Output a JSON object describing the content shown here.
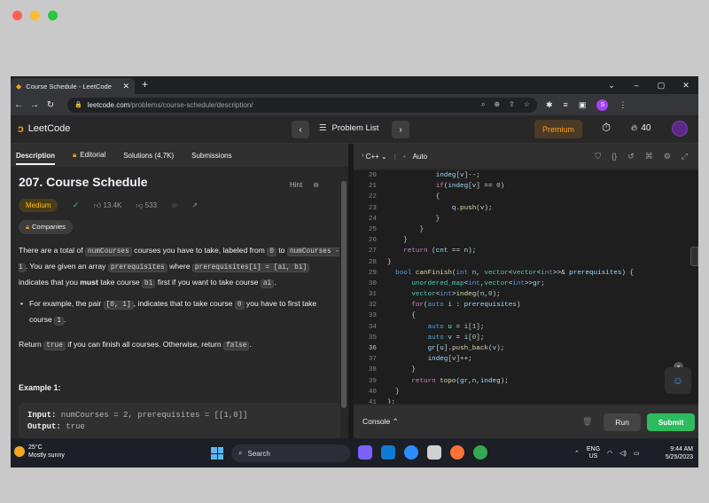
{
  "browser": {
    "tab_title": "Course Schedule - LeetCode",
    "tab_close": "✕",
    "new_tab": "+",
    "url_host": "leetcode.com",
    "url_path": "/problems/course-schedule/description/",
    "profile_initial": "S",
    "window_controls": [
      "⌄",
      "–",
      "▢",
      "✕"
    ]
  },
  "header": {
    "logo_text": "LeetCode",
    "problem_list": "Problem List",
    "premium": "Premium",
    "streak_count": "40"
  },
  "left": {
    "tabs": [
      "Description",
      "Editorial",
      "Solutions (4.7K)",
      "Submissions"
    ],
    "title": "207. Course Schedule",
    "hint": "Hint",
    "difficulty": "Medium",
    "likes": "13.4K",
    "dislikes": "533",
    "companies": "Companies",
    "p1_a": "There are a total of ",
    "p1_code1": "numCourses",
    "p1_b": " courses you have to take, labeled from ",
    "p1_code2": "0",
    "p1_c": " to ",
    "p1_code3": "numCourses - 1",
    "p1_d": ". You are given an array ",
    "p1_code4": "prerequisites",
    "p1_e": " where ",
    "p1_code5": "prerequisites[i] = [ai, bi]",
    "p1_f": " indicates that you ",
    "p1_must": "must",
    "p1_g": " take course ",
    "p1_code6": "bi",
    "p1_h": " first if you want to take course ",
    "p1_code7": "ai",
    "p1_i": ".",
    "b1_a": "For example, the pair ",
    "b1_code1": "[0, 1]",
    "b1_b": ", indicates that to take course ",
    "b1_code2": "0",
    "b1_c": " you have to first take course ",
    "b1_code3": "1",
    "b1_d": ".",
    "p2_a": "Return ",
    "p2_code1": "true",
    "p2_b": " if you can finish all courses. Otherwise, return ",
    "p2_code2": "false",
    "p2_c": ".",
    "example_heading": "Example 1:",
    "ex_input_label": "Input:",
    "ex_input_value": " numCourses = 2, prerequisites = [[1,0]]",
    "ex_output_label": "Output:",
    "ex_output_value": " true"
  },
  "right": {
    "language": "C++",
    "mode": "Auto",
    "console": "Console",
    "run": "Run",
    "submit": "Submit"
  },
  "code_lines": [
    {
      "n": "20",
      "html": "            <span class='vr'>indeg</span>[<span class='vr'>v</span>]--;"
    },
    {
      "n": "21",
      "html": "            <span class='kw2'>if</span>(<span class='vr'>indeg</span>[<span class='vr'>v</span>] == <span class='nm'>0</span>)"
    },
    {
      "n": "22",
      "html": "            {"
    },
    {
      "n": "23",
      "html": "                <span class='vr'>q</span>.<span class='fn'>push</span>(<span class='vr'>v</span>);"
    },
    {
      "n": "24",
      "html": "            }"
    },
    {
      "n": "25",
      "html": "        }"
    },
    {
      "n": "26",
      "html": "    }"
    },
    {
      "n": "27",
      "html": "    <span class='kw2'>return</span> (<span class='vr'>cnt</span> == <span class='vr'>n</span>);"
    },
    {
      "n": "28",
      "html": "}"
    },
    {
      "n": "29",
      "html": "  <span class='kw'>bool</span> <span class='fn'>canFinish</span>(<span class='kw'>int</span> <span class='vr'>n</span>, <span class='ty'>vector</span>&lt;<span class='ty'>vector</span>&lt;<span class='kw'>int</span>&gt;&gt;&amp; <span class='vr'>prerequisites</span>) {"
    },
    {
      "n": "30",
      "html": "      <span class='ty'>unordered_map</span>&lt;<span class='kw'>int</span>,<span class='ty'>vector</span>&lt;<span class='kw'>int</span>&gt;&gt;<span class='vr'>gr</span>;"
    },
    {
      "n": "31",
      "html": "      <span class='ty'>vector</span>&lt;<span class='kw'>int</span>&gt;<span class='fn'>indeg</span>(<span class='vr'>n</span>,<span class='nm'>0</span>);"
    },
    {
      "n": "32",
      "html": "      <span class='kw2'>for</span>(<span class='kw'>auto</span> <span class='vr'>i</span> : <span class='vr'>prerequisites</span>)"
    },
    {
      "n": "33",
      "html": "      {"
    },
    {
      "n": "34",
      "html": "          <span class='kw'>auto</span> <span class='vr'>u</span> = <span class='vr'>i</span>[<span class='nm'>1</span>];"
    },
    {
      "n": "35",
      "html": "          <span class='kw'>auto</span> <span class='vr'>v</span> = <span class='vr'>i</span>[<span class='nm'>0</span>];"
    },
    {
      "n": "36",
      "html": "          <span class='vr'>gr</span>[<span class='vr'>u</span>].<span class='fn'>push_back</span>(<span class='vr'>v</span>);"
    },
    {
      "n": "37",
      "html": "          <span class='vr'>indeg</span>[<span class='vr'>v</span>]++;"
    },
    {
      "n": "38",
      "html": "      }"
    },
    {
      "n": "39",
      "html": "      <span class='kw2'>return</span> <span class='fn'>topo</span>(<span class='vr'>gr</span>,<span class='vr'>n</span>,<span class='vr'>indeg</span>);"
    },
    {
      "n": "40",
      "html": "  }"
    },
    {
      "n": "41",
      "html": "};"
    }
  ],
  "taskbar": {
    "temp": "25°C",
    "weather": "Mostly sunny",
    "search": "Search",
    "lang1": "ENG",
    "lang2": "US",
    "time": "9:44 AM",
    "date": "5/25/2023"
  },
  "colors": {
    "accent": "#ffa116",
    "submit": "#2cbb5d",
    "medium": "#ffc01e"
  }
}
